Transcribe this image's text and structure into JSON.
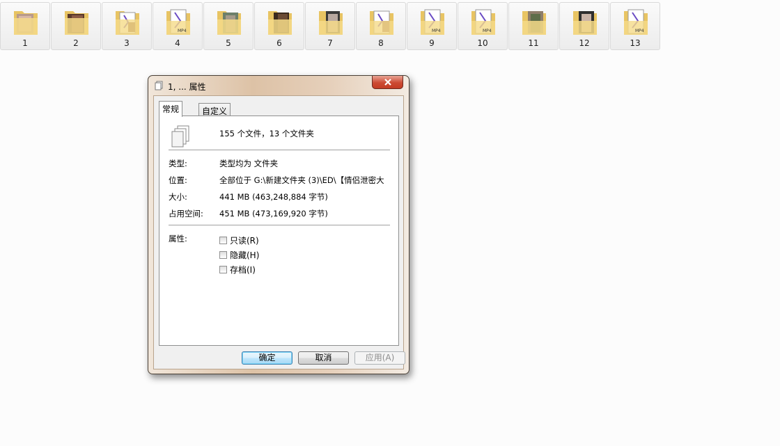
{
  "folders": [
    "1",
    "2",
    "3",
    "4",
    "5",
    "6",
    "7",
    "8",
    "9",
    "10",
    "11",
    "12",
    "13"
  ],
  "dialog": {
    "title": "1, ... 属性",
    "tabs": [
      "常规",
      "自定义"
    ],
    "summary": "155 个文件，13 个文件夹",
    "rows": [
      {
        "label": "类型:",
        "value": "类型均为 文件夹"
      },
      {
        "label": "位置:",
        "value": "全部位于 G:\\新建文件夹 (3)\\ED\\【情侣泄密大"
      },
      {
        "label": "大小:",
        "value": "441 MB (463,248,884 字节)"
      },
      {
        "label": "占用空间:",
        "value": "451 MB (473,169,920 字节)"
      }
    ],
    "attributes_label": "属性:",
    "checkboxes": [
      "只读(R)",
      "隐藏(H)",
      "存档(I)"
    ],
    "buttons": {
      "ok": "确定",
      "cancel": "取消",
      "apply": "应用(A)"
    }
  },
  "colors": {
    "folder": "#f3d27a",
    "title_glass": "#ddc2a6",
    "close": "#cc4a33"
  }
}
